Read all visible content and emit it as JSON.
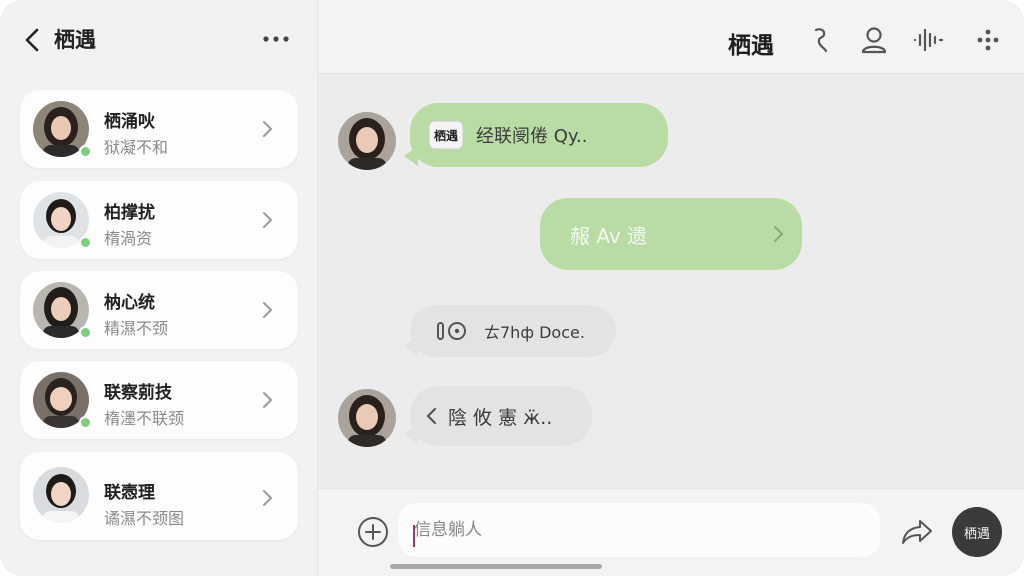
{
  "sidebar": {
    "title": "栖遇",
    "contacts": [
      {
        "name": "栖涌吙",
        "status": "狱凝不和",
        "online": true
      },
      {
        "name": "柏撑扰",
        "status": "楕渦资",
        "online": true
      },
      {
        "name": "枘心统",
        "status": "精濕不颈",
        "online": true
      },
      {
        "name": "联察莂技",
        "status": "楕濹不联颈",
        "online": true
      },
      {
        "name": "联悫理",
        "status": "谲濕不颈图",
        "online": false
      }
    ]
  },
  "chat": {
    "title": "栖遇",
    "header_icons": [
      "phone-icon",
      "user-icon",
      "voice-wave-icon",
      "settings-icon"
    ],
    "messages": [
      {
        "side": "incoming",
        "style": "green",
        "icon_text": "栖遇",
        "text": "经联阌倦 Qy.."
      },
      {
        "side": "outgoing",
        "style": "green",
        "text": "赧  Av  遗"
      },
      {
        "side": "incoming",
        "style": "grey",
        "icon": "voice-message-icon",
        "text": "ㄊ7hф Doce."
      },
      {
        "side": "incoming",
        "style": "grey",
        "text": "陰 攸 憲   ӝ.."
      }
    ]
  },
  "composer": {
    "placeholder": "信息躺人",
    "me_avatar_label": "栖遇"
  },
  "colors": {
    "accent_green": "#b9dca4",
    "online_green": "#7ccf7c",
    "bubble_grey": "#e3e3e3"
  }
}
